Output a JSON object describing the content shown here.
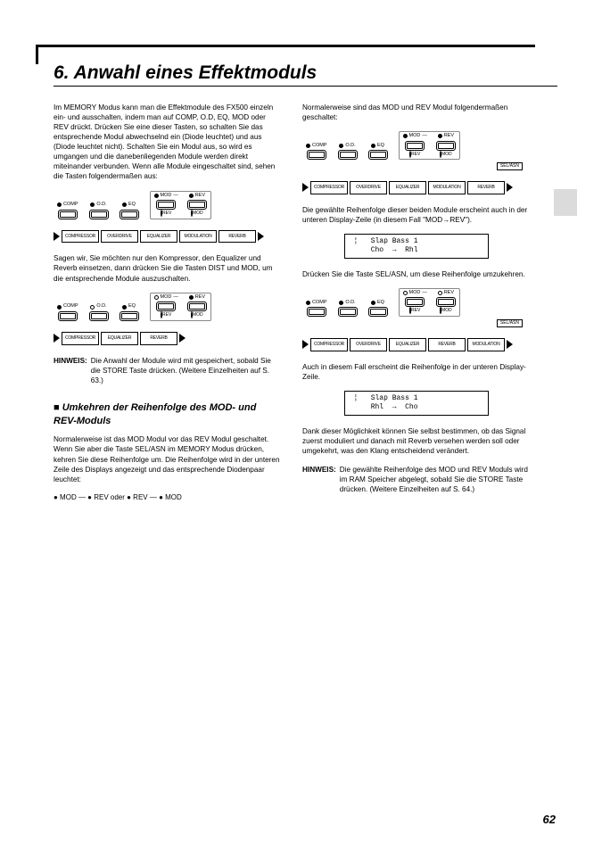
{
  "title": "6. Anwahl eines Effektmoduls",
  "pagenum": "62",
  "left": {
    "p1": "Im MEMORY Modus kann man die Effektmodule des FX500 einzeln ein- und ausschalten, indem man auf COMP, O.D, EQ, MOD oder REV drückt. Drücken Sie eine dieser Tasten, so schalten Sie das entsprechende Modul abwechselnd ein (Diode leuchtet) und aus (Diode leuchtet nicht). Schalten Sie ein Modul aus, so wird es umgangen und die danebenliegenden Module werden direkt miteinander verbunden. Wenn alle Module eingeschaltet sind, sehen die Tasten folgendermaßen aus:",
    "panel1": {
      "labels": [
        "COMP",
        "O.D.",
        "EQ",
        "MOD",
        "REV"
      ],
      "sub1": "REV",
      "sub2": "MOD",
      "fills": [
        true,
        true,
        true,
        true,
        true
      ]
    },
    "chain1": [
      "COMPRESSOR",
      "OVERDRIVE",
      "EQUALIZER",
      "MODULATION",
      "REVERB"
    ],
    "p2": "Sagen wir, Sie möchten nur den Kompressor, den Equalizer und Reverb einsetzen, dann drücken Sie die Tasten DIST und MOD, um die entsprechende Module auszuschalten.",
    "panel2": {
      "labels": [
        "COMP",
        "O.D.",
        "EQ",
        "MOD",
        "REV"
      ],
      "sub1": "REV",
      "sub2": "MOD",
      "fills": [
        true,
        false,
        true,
        false,
        true
      ]
    },
    "chain2": [
      "COMPRESSOR",
      "EQUALIZER",
      "REVERB"
    ],
    "hinweis_lbl": "HINWEIS:",
    "hinweis": "Die Anwahl der Module wird mit gespeichert, sobald Sie die STORE Taste drücken. (Weitere Einzelheiten auf S. 63.)",
    "sub_h": "Umkehren der Reihenfolge des MOD- und REV-Moduls",
    "p3": "Normalerweise ist das MOD Modul vor das REV Modul geschaltet. Wenn Sie aber die Taste SEL/ASN im MEMORY Modus drücken, kehren Sie diese Reihenfolge um. Die Reihenfolge wird in der unteren Zeile des Displays angezeigt und das entsprechende Diodenpaar leuchtet:",
    "seq": "● MOD — ● REV oder ● REV — ● MOD"
  },
  "right": {
    "p1": "Normalerweise sind das MOD und REV Modul folgendermaßen geschaltet:",
    "panel1": {
      "labels": [
        "COMP",
        "O.D.",
        "EQ",
        "MOD",
        "REV"
      ],
      "sub1": "REV",
      "sub2": "MOD",
      "fills": [
        true,
        true,
        true,
        true,
        true
      ],
      "selasn": "SEL/ASN"
    },
    "chain1": [
      "COMPRESSOR",
      "OVERDRIVE",
      "EQUALIZER",
      "MODULATION",
      "REVERB"
    ],
    "p2": "Die gewählte Reihenfolge dieser beiden Module erscheint auch in der unteren Display-Zeile (in diesem Fall \"MOD→REV\").",
    "lcd1": "¦   Slap Bass 1\n    Cho  →  Rhl",
    "p3": "Drücken Sie die Taste SEL/ASN, um diese Reihenfolge umzukehren.",
    "panel2": {
      "labels": [
        "COMP",
        "O.D.",
        "EQ",
        "MOD",
        "REV"
      ],
      "sub1": "REV",
      "sub2": "MOD",
      "fills": [
        true,
        true,
        true,
        false,
        false
      ],
      "subfills": [
        true,
        true
      ],
      "selasn": "SEL/ASN"
    },
    "chain2": [
      "COMPRESSOR",
      "OVERDRIVE",
      "EQUALIZER",
      "REVERB",
      "MODULATION"
    ],
    "p4": "Auch in diesem Fall erscheint die Reihenfolge in der unteren Display-Zeile.",
    "lcd2": "¦   Slap Bass 1\n    Rhl  →  Cho",
    "p5": "Dank dieser Möglichkeit können Sie selbst bestimmen, ob das Signal zuerst moduliert und danach mit Reverb versehen werden soll oder umgekehrt, was den Klang entscheidend verändert.",
    "hinweis_lbl": "HINWEIS:",
    "hinweis": "Die gewählte Reihenfolge des MOD und REV Moduls wird im RAM Speicher abgelegt, sobald Sie die STORE Taste drücken. (Weitere Einzelheiten auf S. 64.)"
  }
}
